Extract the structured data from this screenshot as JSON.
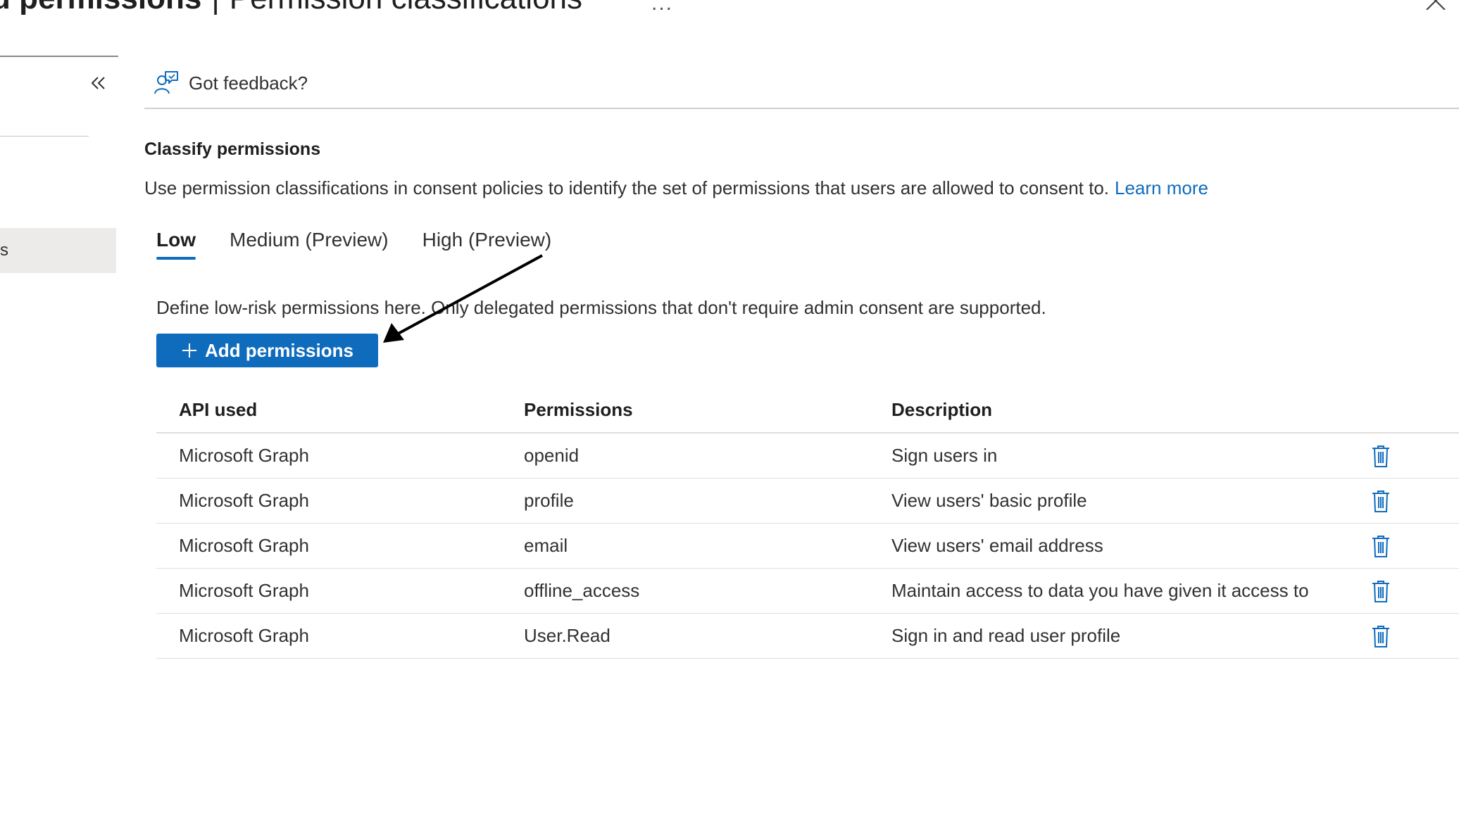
{
  "header": {
    "title_bold": "d permissions",
    "separator": "|",
    "title_sub": "Permission classifications",
    "more_label": "..."
  },
  "nav": {
    "selected_item_label": "s"
  },
  "feedback": {
    "label": "Got feedback?",
    "icon": "feedback-person-icon"
  },
  "section": {
    "title": "Classify permissions",
    "description": "Use permission classifications in consent policies to identify the set of permissions that users are allowed to consent to.",
    "learn_more": "Learn more"
  },
  "tabs": [
    {
      "label": "Low",
      "active": true
    },
    {
      "label": "Medium (Preview)",
      "active": false
    },
    {
      "label": "High (Preview)",
      "active": false
    }
  ],
  "define_text": "Define low-risk permissions here. Only delegated permissions that don't require admin consent are supported.",
  "add_button": {
    "label": "Add permissions",
    "icon": "plus-icon"
  },
  "table": {
    "columns": [
      "API used",
      "Permissions",
      "Description"
    ],
    "rows": [
      {
        "api": "Microsoft Graph",
        "permission": "openid",
        "description": "Sign users in"
      },
      {
        "api": "Microsoft Graph",
        "permission": "profile",
        "description": "View users' basic profile"
      },
      {
        "api": "Microsoft Graph",
        "permission": "email",
        "description": "View users' email address"
      },
      {
        "api": "Microsoft Graph",
        "permission": "offline_access",
        "description": "Maintain access to data you have given it access to"
      },
      {
        "api": "Microsoft Graph",
        "permission": "User.Read",
        "description": "Sign in and read user profile"
      }
    ]
  },
  "colors": {
    "accent": "#0f6cbd",
    "tab_underline": "#0f6cbd",
    "nav_selected_bg": "#edebe9"
  }
}
